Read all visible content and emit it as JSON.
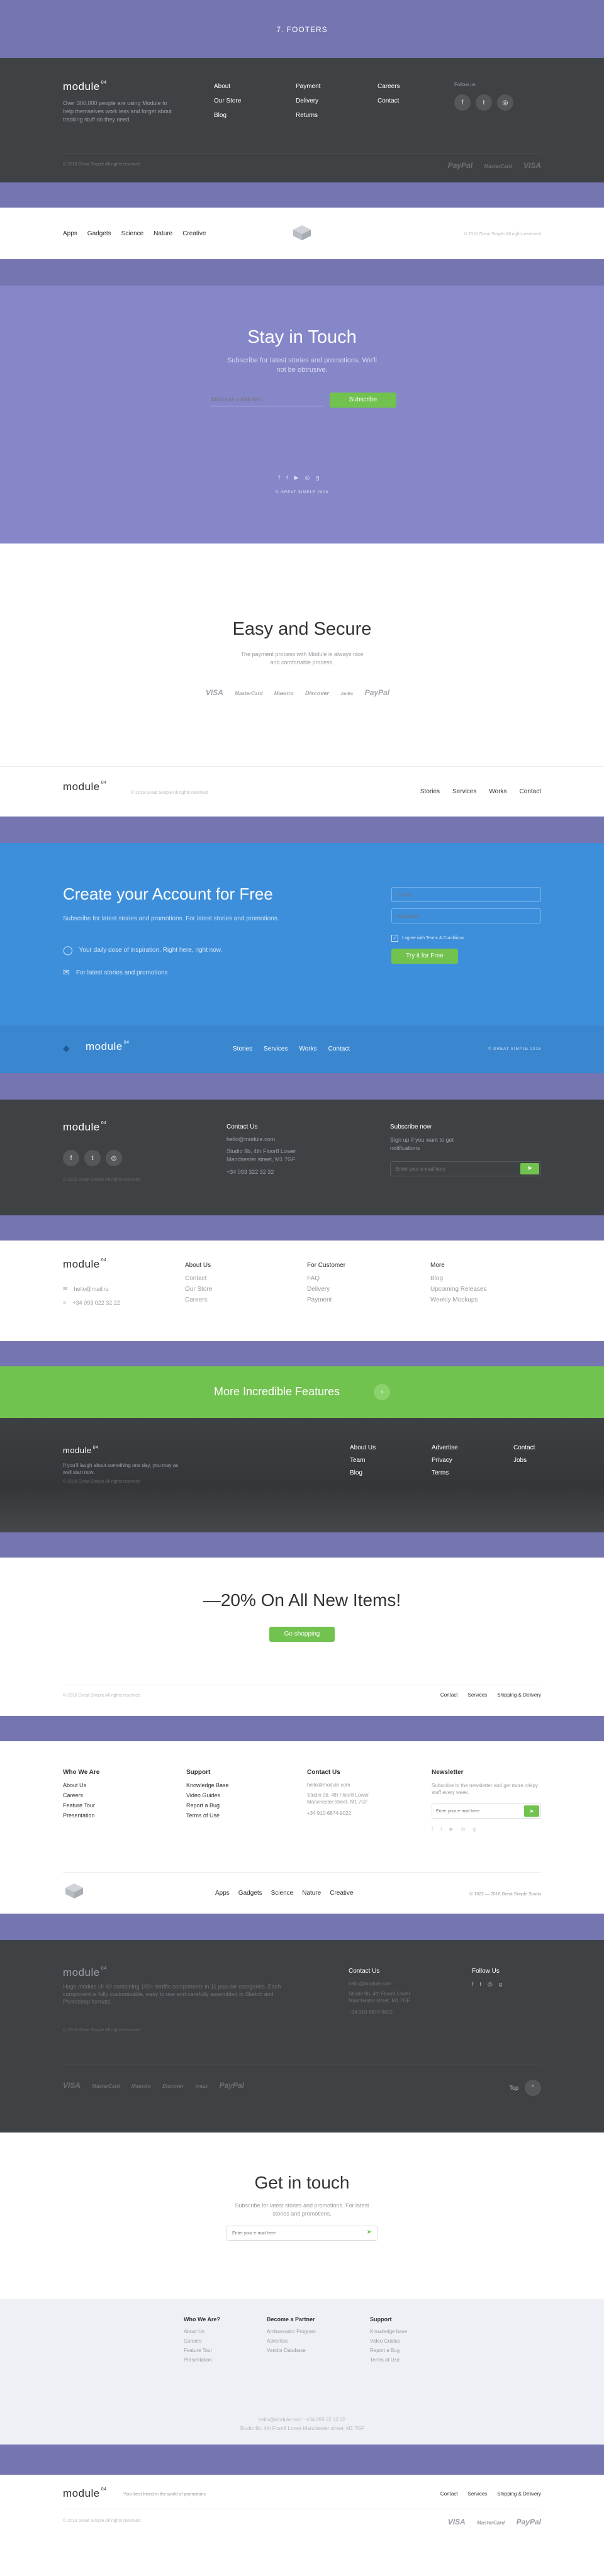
{
  "title": "7. FOOTERS",
  "f1": {
    "logo": "module",
    "sup": "04",
    "desc": "Over 300,000 people are using Module to help themselves work less and forget about tracking stuff do they need.",
    "col1": [
      "About",
      "Our Store",
      "Blog"
    ],
    "col2": [
      "Payment",
      "Delivery",
      "Returns"
    ],
    "col3": [
      "Careers",
      "Contact"
    ],
    "follow": "Follow us",
    "copy": "© 2016 Great Simple All rights reserved",
    "payments": [
      "PayPal",
      "MasterCard",
      "VISA"
    ]
  },
  "f2": {
    "nav": [
      "Apps",
      "Gadgets",
      "Science",
      "Nature",
      "Creative"
    ],
    "copy": "© 2016 Great Simple All rights reserved"
  },
  "f3": {
    "heading": "Stay in Touch",
    "sub": "Subscribe for latest stories and promotions. We'll not be obtrusive.",
    "placeholder": "Enter your e-mail here",
    "button": "Subscribe",
    "copy": "© GREAT SIMPLE 2016"
  },
  "f4": {
    "heading": "Easy and Secure",
    "sub": "The payment process with Module is always nice and comfortable process.",
    "payments": [
      "VISA",
      "MasterCard",
      "Maestro",
      "Discover",
      "AmEx",
      "PayPal"
    ]
  },
  "f5": {
    "logo": "module",
    "sup": "04",
    "copy": "© 2016 Great Simple All rights reserved",
    "nav": [
      "Stories",
      "Services",
      "Works",
      "Contact"
    ]
  },
  "f6": {
    "heading": "Create your Account for Free",
    "sub": "Subscribe for latest stories and promotions. For latest stories and promotions.",
    "item1": "Your daily dose of inspiration. Right here, right now.",
    "item2": "For latest stories and promotions",
    "email_placeholder": "E-mail",
    "password_placeholder": "Password",
    "agree": "I agree with Terms & Conditions",
    "button": "Try it for Free",
    "logo": "module",
    "sup": "04",
    "nav": [
      "Stories",
      "Services",
      "Works",
      "Contact"
    ],
    "copy": "© GREAT SIMPLE 2016"
  },
  "f7": {
    "logo": "module",
    "sup": "04",
    "contact_title": "Contact Us",
    "email": "hello@module.com",
    "address": "Studio 9b, 4th Floor8 Lower Manchester street, M1 7GF",
    "phone": "+34 093 322 32 32",
    "copy": "© 2016 Great Simple All rights reserved",
    "sub_title": "Subscribe now",
    "sub_text": "Sign up if you want to get notifications",
    "placeholder": "Enter your e-mail here"
  },
  "f8": {
    "logo": "module",
    "sup": "04",
    "email": "hello@mail.ru",
    "phone": "+34 093 022 32 22",
    "about_title": "About Us",
    "about": [
      "Contact",
      "Our Store",
      "Careers"
    ],
    "cust_title": "For Customer",
    "cust": [
      "FAQ",
      "Delivery",
      "Payment"
    ],
    "more_title": "More",
    "more": [
      "Blog",
      "Upcoming Releases",
      "Weekly Mockups"
    ]
  },
  "f9": {
    "banner": "More Incredible Features",
    "logo": "module",
    "sup": "04",
    "desc": "If you'll laugh about something one day, you may as well start now.",
    "copy": "© 2016 Great Simple All rights reserved",
    "col1": [
      "About Us",
      "Team",
      "Blog"
    ],
    "col2": [
      "Advertise",
      "Privacy",
      "Terms"
    ],
    "col3": [
      "Contact",
      "Jobs"
    ]
  },
  "f10": {
    "heading": "—20% On All New Items!",
    "button": "Go shopping",
    "copy": "© 2016 Great Simple All rights reserved",
    "nav": [
      "Contact",
      "Services",
      "Shipping & Delivery"
    ]
  },
  "f11": {
    "who_title": "Who We Are",
    "who": [
      "About Us",
      "Careers",
      "Feature Tour",
      "Presentation"
    ],
    "support_title": "Support",
    "support": [
      "Knowledge Base",
      "Video Guides",
      "Report a Bug",
      "Terms of Use"
    ],
    "contact_title": "Contact Us",
    "email": "hello@module.com",
    "address": "Studio 9b, 4th Floor8 Lower Manchester street, M1 7GF",
    "phone": "+34 910-6874-9022",
    "news_title": "Newsletter",
    "news_text": "Subscribe to the newsletter and get more crispy stuff every week.",
    "placeholder": "Enter your e-mail here",
    "nav": [
      "Apps",
      "Gadgets",
      "Science",
      "Nature",
      "Creative"
    ],
    "copy": "© 1822 — 2016 Great Simple Studio"
  },
  "f12": {
    "logo": "module",
    "sup": "04",
    "desc": "Huge module UI Kit containing 100+ terrific components in 11 popular categories. Each component is fully customizable, easy to use and carefully assembled in Sketch and Photoshop formats.",
    "copy": "© 2016 Great Simple All rights reserved",
    "contact_title": "Contact Us",
    "email": "hello@module.com",
    "address": "Studio 9b, 4th Floor8 Lower Manchester street, M1 7GF",
    "phone": "+34 910-6874-9022",
    "follow_title": "Follow Us",
    "top": "Top",
    "payments": [
      "VISA",
      "MasterCard",
      "Maestro",
      "Discover",
      "AmEx",
      "PayPal"
    ]
  },
  "f13": {
    "heading": "Get in touch",
    "sub": "Subscribe for latest stories and promotions. For latest stories and promotions.",
    "placeholder": "Enter your e-mail here",
    "who_title": "Who We Are?",
    "who": [
      "About Us",
      "Careers",
      "Feature Tour",
      "Presentation"
    ],
    "partner_title": "Become a Partner",
    "partner": [
      "Ambassador Program",
      "Advertise",
      "Vendor Database"
    ],
    "support_title": "Support",
    "support": [
      "Knowledge base",
      "Video Guides",
      "Report a Bug",
      "Terms of Use"
    ],
    "contact_line": "hello@module.com  ·  +34 093 22 32 32",
    "address": "Studio 9b, 4th Floor8 Lower Manchester street, M1 7GF"
  },
  "f14": {
    "logo": "module",
    "sup": "04",
    "tagline": "Your best friend in the world of promotions",
    "nav": [
      "Contact",
      "Services",
      "Shipping & Delivery"
    ],
    "copy": "© 2016 Great Simple All rights reserved",
    "payments": [
      "VISA",
      "MasterCard",
      "PayPal"
    ]
  }
}
